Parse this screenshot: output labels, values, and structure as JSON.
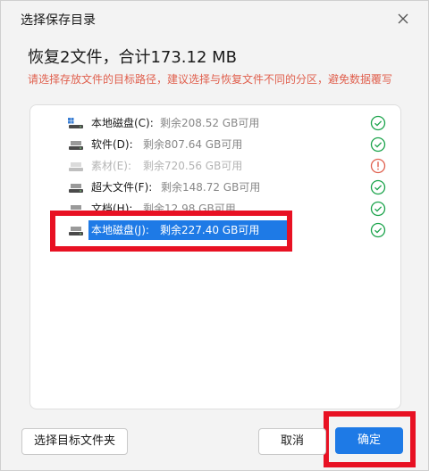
{
  "dialog": {
    "title": "选择保存目录",
    "heading": "恢复2文件，合计173.12 MB",
    "warning": "请选择存放文件的目标路径，建议选择与恢复文件不同的分区，避免数据覆写"
  },
  "drives": [
    {
      "label": "本地磁盘(C):",
      "free": "剩余208.52 GB可用",
      "status": "ok",
      "state": "normal"
    },
    {
      "label": "软件(D):",
      "free": "剩余807.64 GB可用",
      "status": "ok",
      "state": "normal"
    },
    {
      "label": "素材(E):",
      "free": "剩余720.56 GB可用",
      "status": "warning",
      "state": "disabled"
    },
    {
      "label": "超大文件(F):",
      "free": "剩余148.72 GB可用",
      "status": "ok",
      "state": "normal"
    },
    {
      "label": "文档(H):",
      "free": "剩余12.98 GB可用",
      "status": "ok",
      "state": "normal"
    },
    {
      "label": "本地磁盘(J):",
      "free": "剩余227.40 GB可用",
      "status": "ok",
      "state": "selected"
    }
  ],
  "buttons": {
    "choose_folder": "选择目标文件夹",
    "cancel": "取消",
    "confirm": "确定"
  },
  "icons": {
    "close": "close-icon",
    "drive": "drive-icon",
    "ok": "check-circle-icon",
    "warning": "info-circle-icon"
  },
  "colors": {
    "accent": "#1e7ae6",
    "ok_green": "#1aa34a",
    "warning_red": "#e0604e",
    "highlight_box": "#e81123"
  }
}
